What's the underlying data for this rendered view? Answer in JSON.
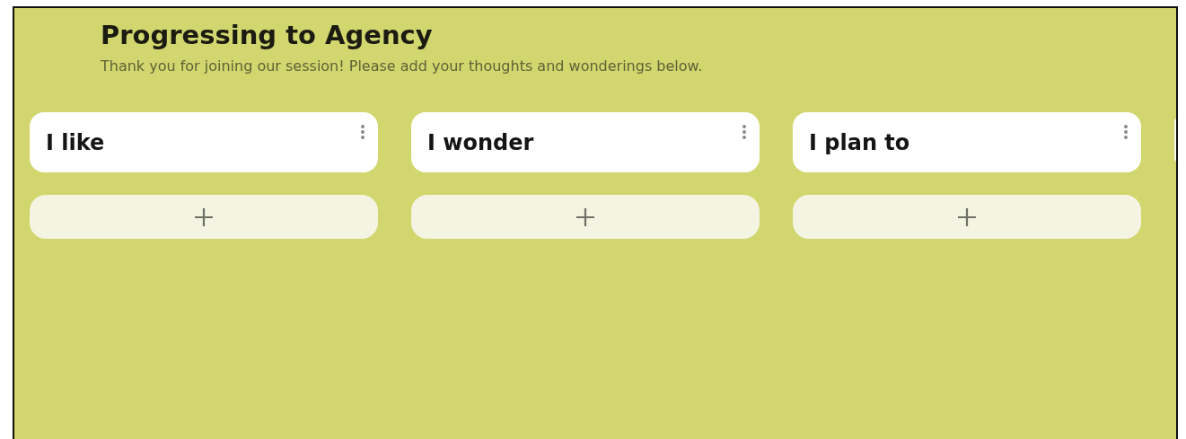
{
  "board": {
    "title": "Progressing to Agency",
    "description": "Thank you for joining our session! Please add your thoughts and wonderings below."
  },
  "columns": [
    {
      "title": "I like"
    },
    {
      "title": "I wonder"
    },
    {
      "title": "I plan to"
    }
  ]
}
